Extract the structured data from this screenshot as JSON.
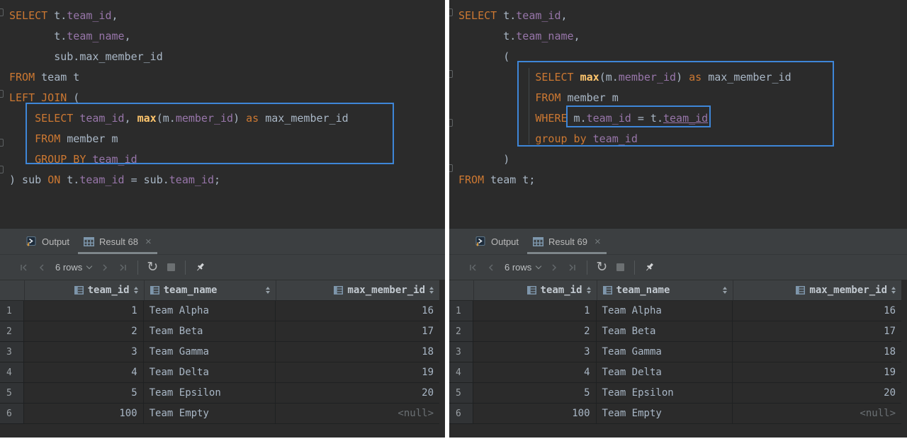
{
  "theme": {
    "editor_bg": "#2b2b2b",
    "panel_bg": "#3c3f41",
    "keyword_color": "#cc7832",
    "column_ref_color": "#9876aa",
    "function_color": "#ffc66d",
    "plain_text_color": "#a9b7c6",
    "highlight_box_color": "#3e86d8",
    "null_value_color": "#6b7074"
  },
  "panels": [
    {
      "side": "left",
      "editor": {
        "lines": [
          [
            [
              "kw",
              "SELECT"
            ],
            [
              "pl",
              " t."
            ],
            [
              "id",
              "team_id"
            ],
            [
              "pl",
              ","
            ]
          ],
          [
            [
              "pl",
              "       t."
            ],
            [
              "id",
              "team_name"
            ],
            [
              "pl",
              ","
            ]
          ],
          [
            [
              "pl",
              "       sub.max_member_id"
            ]
          ],
          [
            [
              "kw",
              "FROM"
            ],
            [
              "pl",
              " team t"
            ]
          ],
          [
            [
              "kw",
              "LEFT JOIN"
            ],
            [
              "pl",
              " ("
            ]
          ],
          [
            [
              "pl",
              "    "
            ],
            [
              "kw",
              "SELECT"
            ],
            [
              "pl",
              " "
            ],
            [
              "id",
              "team_id"
            ],
            [
              "pl",
              ", "
            ],
            [
              "fn",
              "max"
            ],
            [
              "pl",
              "(m."
            ],
            [
              "id",
              "member_id"
            ],
            [
              "pl",
              ") "
            ],
            [
              "kw",
              "as"
            ],
            [
              "pl",
              " max_member_id"
            ]
          ],
          [
            [
              "pl",
              "    "
            ],
            [
              "kw",
              "FROM"
            ],
            [
              "pl",
              " member m"
            ]
          ],
          [
            [
              "pl",
              "    "
            ],
            [
              "kw",
              "GROUP BY"
            ],
            [
              "pl",
              " "
            ],
            [
              "id",
              "team_id"
            ]
          ],
          [
            [
              "pl",
              ") sub "
            ],
            [
              "kw",
              "ON"
            ],
            [
              "pl",
              " t."
            ],
            [
              "id",
              "team_id"
            ],
            [
              "pl",
              " = sub."
            ],
            [
              "id",
              "team_id"
            ],
            [
              "pl",
              ";"
            ]
          ]
        ]
      },
      "tabs": {
        "output_label": "Output",
        "result_label": "Result 68",
        "close_glyph": "×"
      },
      "toolbar": {
        "rows_label": "6 rows",
        "refresh_glyph": "↻"
      },
      "table": {
        "columns": [
          "team_id",
          "team_name",
          "max_member_id"
        ],
        "rows": [
          [
            "1",
            "1",
            "Team Alpha",
            "16"
          ],
          [
            "2",
            "2",
            "Team Beta",
            "17"
          ],
          [
            "3",
            "3",
            "Team Gamma",
            "18"
          ],
          [
            "4",
            "4",
            "Team Delta",
            "19"
          ],
          [
            "5",
            "5",
            "Team Epsilon",
            "20"
          ],
          [
            "6",
            "100",
            "Team Empty",
            "<null>"
          ]
        ]
      }
    },
    {
      "side": "right",
      "editor": {
        "lines": [
          [
            [
              "kw",
              "SELECT"
            ],
            [
              "pl",
              " t."
            ],
            [
              "id",
              "team_id"
            ],
            [
              "pl",
              ","
            ]
          ],
          [
            [
              "pl",
              "       t."
            ],
            [
              "id",
              "team_name"
            ],
            [
              "pl",
              ","
            ]
          ],
          [
            [
              "pl",
              "       ("
            ]
          ],
          [
            [
              "pl",
              "            "
            ],
            [
              "kw",
              "SELECT"
            ],
            [
              "pl",
              " "
            ],
            [
              "fn",
              "max"
            ],
            [
              "pl",
              "(m."
            ],
            [
              "id",
              "member_id"
            ],
            [
              "pl",
              ") "
            ],
            [
              "kw",
              "as"
            ],
            [
              "pl",
              " max_member_id"
            ]
          ],
          [
            [
              "pl",
              "            "
            ],
            [
              "kw",
              "FROM"
            ],
            [
              "pl",
              " member m"
            ]
          ],
          [
            [
              "pl",
              "            "
            ],
            [
              "kw",
              "WHERE"
            ],
            [
              "pl",
              " m."
            ],
            [
              "id",
              "team_id"
            ],
            [
              "pl",
              " = t."
            ],
            [
              "idu",
              "team_id"
            ]
          ],
          [
            [
              "pl",
              "            "
            ],
            [
              "kw",
              "group by"
            ],
            [
              "pl",
              " "
            ],
            [
              "id",
              "team_id"
            ]
          ],
          [
            [
              "pl",
              "       )"
            ]
          ],
          [
            [
              "kw",
              "FROM"
            ],
            [
              "pl",
              " team t;"
            ]
          ]
        ]
      },
      "tabs": {
        "output_label": "Output",
        "result_label": "Result 69",
        "close_glyph": "×"
      },
      "toolbar": {
        "rows_label": "6 rows",
        "refresh_glyph": "↻"
      },
      "table": {
        "columns": [
          "team_id",
          "team_name",
          "max_member_id"
        ],
        "rows": [
          [
            "1",
            "1",
            "Team Alpha",
            "16"
          ],
          [
            "2",
            "2",
            "Team Beta",
            "17"
          ],
          [
            "3",
            "3",
            "Team Gamma",
            "18"
          ],
          [
            "4",
            "4",
            "Team Delta",
            "19"
          ],
          [
            "5",
            "5",
            "Team Epsilon",
            "20"
          ],
          [
            "6",
            "100",
            "Team Empty",
            "<null>"
          ]
        ]
      }
    }
  ]
}
